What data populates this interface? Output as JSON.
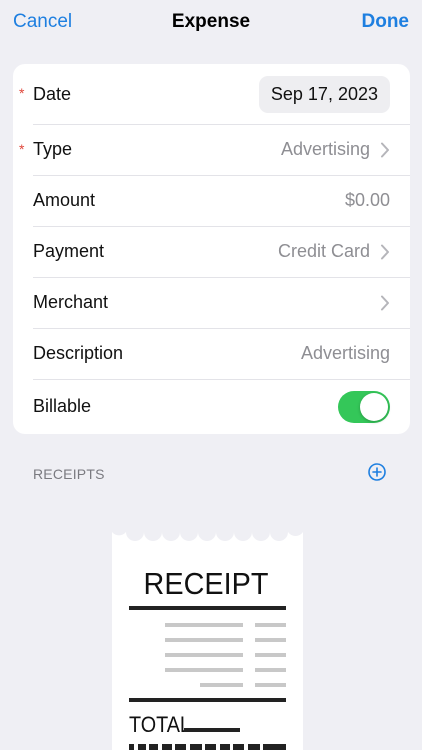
{
  "nav": {
    "cancel_label": "Cancel",
    "title": "Expense",
    "done_label": "Done"
  },
  "form": {
    "date": {
      "label": "Date",
      "value": "Sep 17, 2023",
      "required_mark": "*"
    },
    "type": {
      "label": "Type",
      "value": "Advertising",
      "required_mark": "*"
    },
    "amount": {
      "label": "Amount",
      "value": "$0.00"
    },
    "payment": {
      "label": "Payment",
      "value": "Credit Card"
    },
    "merchant": {
      "label": "Merchant",
      "value": ""
    },
    "description": {
      "label": "Description",
      "placeholder": "Advertising"
    },
    "billable": {
      "label": "Billable",
      "on": true
    }
  },
  "receipts": {
    "header": "RECEIPTS",
    "image_text": {
      "title": "RECEIPT",
      "total": "TOTAL"
    }
  },
  "colors": {
    "accent": "#1E7FE0",
    "toggle_on": "#34C759",
    "required": "#E0463A",
    "background": "#EFEFF4"
  },
  "icons": {
    "chevron": "chevron-right-icon",
    "add": "plus-circle-icon"
  }
}
